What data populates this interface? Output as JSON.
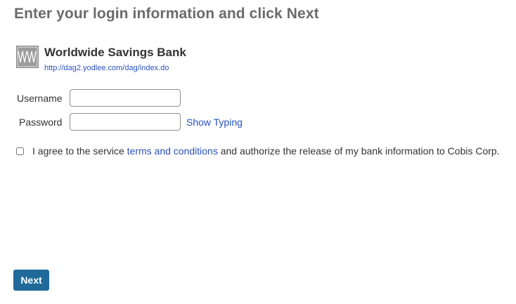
{
  "heading": "Enter your login information and click Next",
  "bank": {
    "name": "Worldwide Savings Bank",
    "url": "http://dag2.yodlee.com/dag/index.do",
    "logo_icon": "bank-logo-icon"
  },
  "form": {
    "username_label": "Username",
    "username_value": "",
    "password_label": "Password",
    "password_value": "",
    "show_typing_label": "Show Typing"
  },
  "agreement": {
    "checked": false,
    "text_before": "I agree to the service ",
    "link_text": "terms and conditions",
    "text_after": " and authorize the release of my bank information to Cobis Corp."
  },
  "actions": {
    "next_label": "Next"
  },
  "colors": {
    "heading": "#6b6b6b",
    "link": "#2a52be",
    "button": "#1f6a99"
  }
}
